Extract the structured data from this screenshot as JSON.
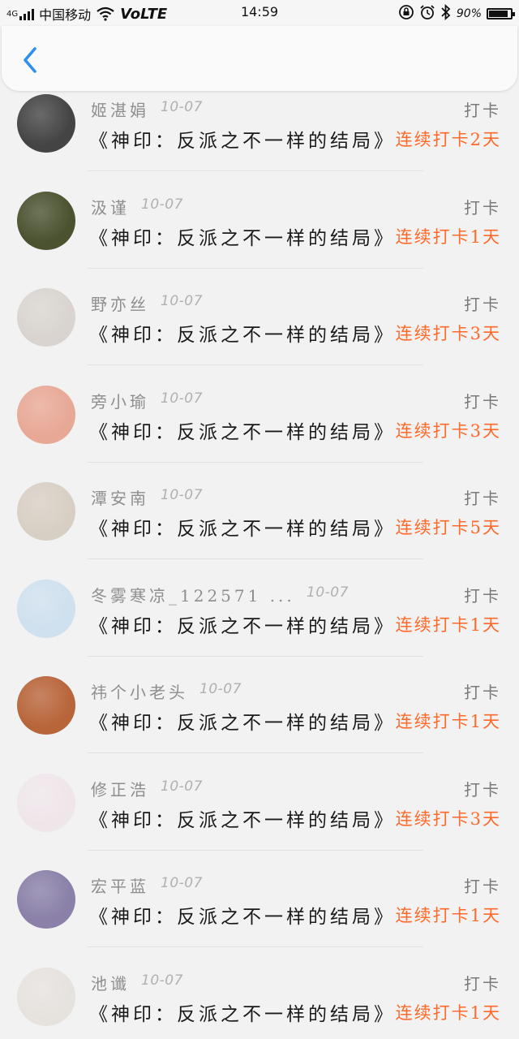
{
  "status_bar": {
    "network": "4G",
    "carrier": "中国移动",
    "volte": "VoLTE",
    "time": "14:59",
    "battery_text": "90%",
    "battery_level": 0.9
  },
  "nav": {
    "back_icon": "chevron-left-icon",
    "accent_color": "#2f8ff0"
  },
  "list": {
    "items": [
      {
        "name": "姬湛娟",
        "date": "10-07",
        "tag": "打卡",
        "book": "《神印：反派之不一样的结局》",
        "streak": "连续打卡2天",
        "avatar_color": "#444444"
      },
      {
        "name": "汲谨",
        "date": "10-07",
        "tag": "打卡",
        "book": "《神印：反派之不一样的结局》",
        "streak": "连续打卡1天",
        "avatar_color": "#4a5230"
      },
      {
        "name": "野亦丝",
        "date": "10-07",
        "tag": "打卡",
        "book": "《神印：反派之不一样的结局》",
        "streak": "连续打卡3天",
        "avatar_color": "#d9d4cf"
      },
      {
        "name": "旁小瑜",
        "date": "10-07",
        "tag": "打卡",
        "book": "《神印：反派之不一样的结局》",
        "streak": "连续打卡3天",
        "avatar_color": "#e8a896"
      },
      {
        "name": "潭安南",
        "date": "10-07",
        "tag": "打卡",
        "book": "《神印：反派之不一样的结局》",
        "streak": "连续打卡5天",
        "avatar_color": "#d8cfc4"
      },
      {
        "name": "冬雾寒凉_122571 ...",
        "date": "10-07",
        "tag": "打卡",
        "book": "《神印：反派之不一样的结局》",
        "streak": "连续打卡1天",
        "avatar_color": "#cfe0ee"
      },
      {
        "name": "祎个小老头",
        "date": "10-07",
        "tag": "打卡",
        "book": "《神印：反派之不一样的结局》",
        "streak": "连续打卡1天",
        "avatar_color": "#b8653a"
      },
      {
        "name": "修正浩",
        "date": "10-07",
        "tag": "打卡",
        "book": "《神印：反派之不一样的结局》",
        "streak": "连续打卡3天",
        "avatar_color": "#efe6ea"
      },
      {
        "name": "宏平蓝",
        "date": "10-07",
        "tag": "打卡",
        "book": "《神印：反派之不一样的结局》",
        "streak": "连续打卡1天",
        "avatar_color": "#8a80a8"
      },
      {
        "name": "池谶",
        "date": "10-07",
        "tag": "打卡",
        "book": "《神印：反派之不一样的结局》",
        "streak": "连续打卡1天",
        "avatar_color": "#e6e2de"
      }
    ]
  }
}
